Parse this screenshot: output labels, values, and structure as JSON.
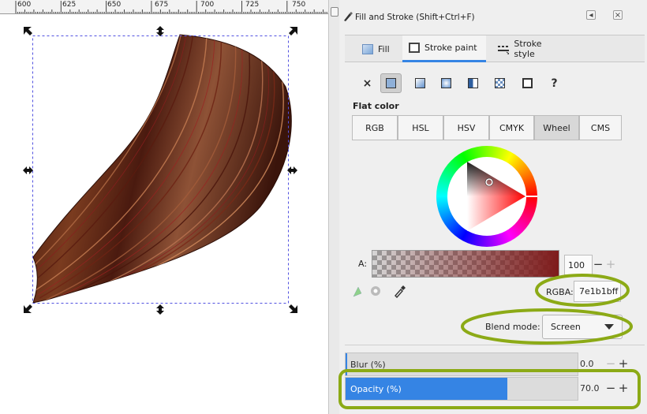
{
  "ruler": {
    "labels": [
      "600",
      "625",
      "650",
      "675",
      "700",
      "725",
      "750"
    ]
  },
  "panel": {
    "title": "Fill and Stroke (Shift+Ctrl+F)",
    "win_buttons": [
      "◂",
      "×"
    ],
    "tabs": [
      {
        "label": "Fill",
        "icon": "fill-icon"
      },
      {
        "label": "Stroke paint",
        "icon": "stroke-paint-icon",
        "active": true
      },
      {
        "label": "Stroke style",
        "icon": "stroke-style-icon"
      }
    ],
    "paint_modes": [
      "no-paint",
      "flat-color",
      "linear-gradient",
      "radial-gradient",
      "mesh-gradient",
      "pattern",
      "swatch",
      "unset"
    ],
    "unset_glyph": "?",
    "no_paint_glyph": "×",
    "flat_label": "Flat color",
    "color_modes": [
      "RGB",
      "HSL",
      "HSV",
      "CMYK",
      "Wheel",
      "CMS"
    ],
    "active_color_mode": "Wheel",
    "alpha_label": "A:",
    "alpha_value": "100",
    "rgba_label": "RGBA:",
    "rgba_value": "7e1b1bff",
    "blend_label": "Blend mode:",
    "blend_value": "Screen",
    "blur_label": "Blur (%)",
    "blur_value": "0.0",
    "opacity_label": "Opacity (%)",
    "opacity_value": "70.0",
    "opacity_fraction": 0.7,
    "minus": "−",
    "plus": "+"
  },
  "colors": {
    "accent": "#3584e4",
    "highlight": "#8caa16",
    "stroke_color": "#7e1b1b",
    "selection_dash": "#5050e0"
  }
}
